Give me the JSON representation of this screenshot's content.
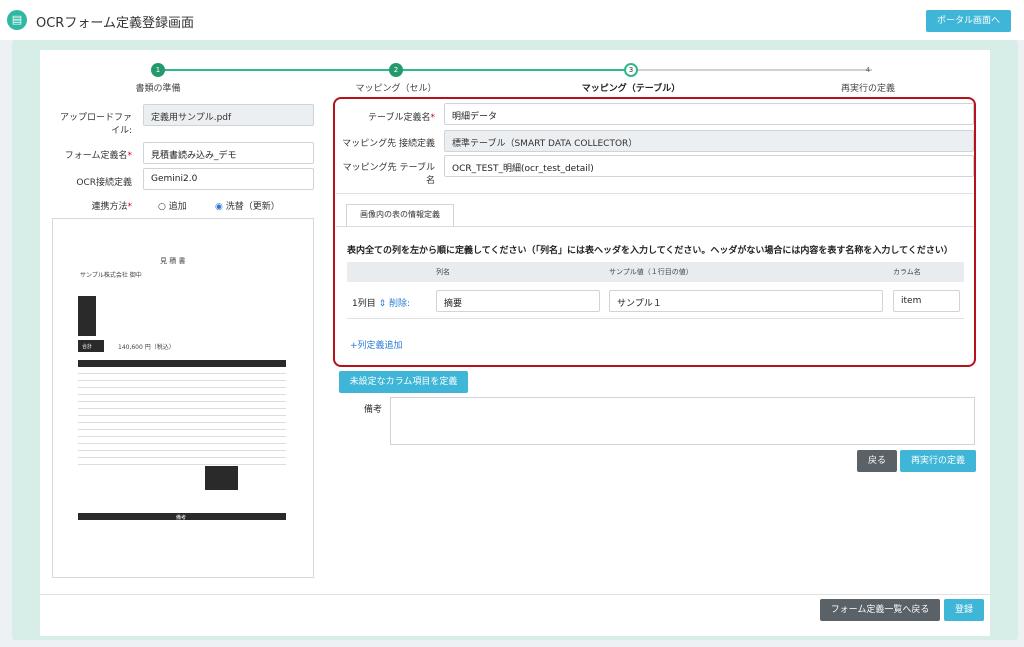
{
  "app": {
    "title": "OCRフォーム定義登録画面",
    "portal_button": "ポータル画面へ"
  },
  "steps": [
    {
      "num": "1",
      "label": "書類の準備"
    },
    {
      "num": "2",
      "label": "マッピング（セル）"
    },
    {
      "num": "3",
      "label": "マッピング（テーブル）"
    },
    {
      "num": "4",
      "label": "再実行の定義"
    }
  ],
  "form": {
    "upload_label_1": "アップロードファ",
    "upload_label_2": "イル:",
    "upload_value": "定義用サンプル.pdf",
    "form_name_label": "フォーム定義名",
    "form_name_value": "見積書読み込み_デモ",
    "ocr_label": "OCR接続定義",
    "ocr_value": "Gemini2.0",
    "link_label": "連携方法",
    "radio_add": "追加",
    "radio_replace": "洗替（更新）"
  },
  "document": {
    "title": "見 積 書",
    "company": "サンプル株式会社 御中",
    "total_label": "合計",
    "total_value": "140,600 円（税込）",
    "footer": "備考"
  },
  "table_def": {
    "name_label": "テーブル定義名",
    "name_value": "明細データ",
    "mapping_conn_label": "マッピング先 接続定義",
    "mapping_conn_value": "標準テーブル（SMART DATA COLLECTOR）",
    "mapping_table_label_1": "マッピング先 テーブル",
    "mapping_table_label_2": "名",
    "mapping_table_value": "OCR_TEST_明細(ocr_test_detail)"
  },
  "tab_label": "画像内の表の情報定義",
  "instruction": "表内全ての列を左から順に定義してください（「列名」には表ヘッダを入力してください。ヘッダがない場合には内容を表す名称を入力してください）",
  "columns_header": {
    "col_name": "列名",
    "sample": "サンプル値（１行目の値）",
    "column_item": "カラム名"
  },
  "column_row": {
    "select": "1列目",
    "delete": "削除:",
    "name": "摘要",
    "sample": "サンプル１",
    "item": "item"
  },
  "add_column": "+列定義追加",
  "undefined_button": "未設定なカラム項目を定義",
  "remarks_label": "備考",
  "buttons": {
    "back": "戻る",
    "rerun": "再実行の定義",
    "back_list": "フォーム定義一覧へ戻る",
    "register": "登録"
  }
}
